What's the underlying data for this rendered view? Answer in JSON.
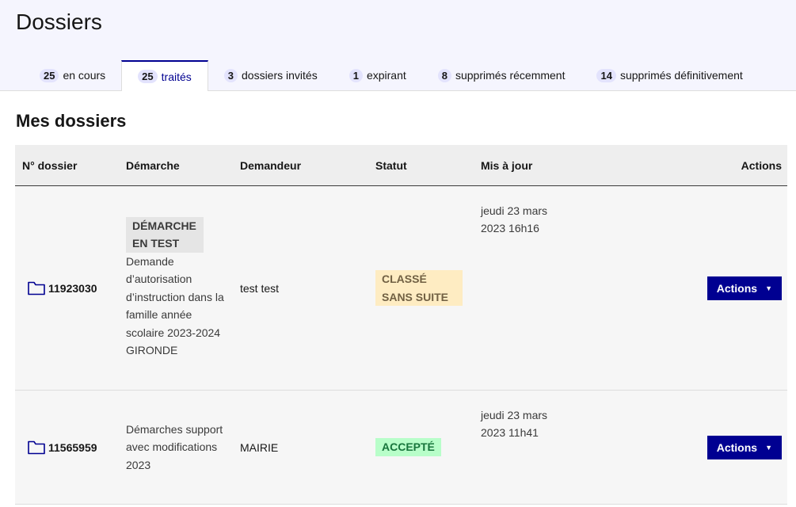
{
  "header": {
    "title": "Dossiers",
    "tabs": [
      {
        "count": "25",
        "label": "en cours",
        "active": false
      },
      {
        "count": "25",
        "label": "traités",
        "active": true
      },
      {
        "count": "3",
        "label": "dossiers invités",
        "active": false
      },
      {
        "count": "1",
        "label": "expirant",
        "active": false
      },
      {
        "count": "8",
        "label": "supprimés récemment",
        "active": false
      },
      {
        "count": "14",
        "label": "supprimés définitivement",
        "active": false
      }
    ]
  },
  "main": {
    "section_title": "Mes dossiers",
    "table": {
      "columns": [
        "N° dossier",
        "Démarche",
        "Demandeur",
        "Statut",
        "Mis à jour",
        "Actions"
      ],
      "rows": [
        {
          "number": "11923030",
          "test_badge": "DÉMARCHE EN TEST",
          "demarche": "Demande d’autorisation d’instruction dans la famille année scolaire 2023-2024 GIRONDE",
          "demandeur": "test test",
          "statut": "CLASSÉ SANS SUITE",
          "date": "jeudi 23 mars 2023 16h16",
          "action": "Actions"
        },
        {
          "number": "11565959",
          "demarche": "Démarches support avec modifications 2023",
          "demandeur": "MAIRIE",
          "statut": "ACCEPTÉ",
          "date": "jeudi 23 mars 2023 11h41",
          "action": "Actions"
        }
      ]
    }
  },
  "icons": {
    "folder": "folder-icon",
    "caret": "chevron-down-icon"
  },
  "colors": {
    "primary": "#000091",
    "header_bg": "#f5f5fe"
  }
}
